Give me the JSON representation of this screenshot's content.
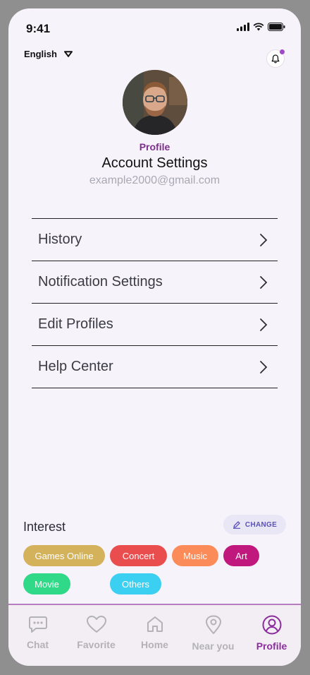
{
  "status": {
    "time": "9:41"
  },
  "language": {
    "selected": "English"
  },
  "profile": {
    "label": "Profile",
    "title": "Account Settings",
    "email": "example2000@gmail.com"
  },
  "menu": {
    "items": [
      {
        "label": "History"
      },
      {
        "label": "Notification Settings"
      },
      {
        "label": "Edit Profiles"
      },
      {
        "label": "Help Center"
      }
    ]
  },
  "interest": {
    "title": "Interest",
    "change_label": "CHANGE",
    "tags": [
      {
        "label": "Games Online",
        "color": "#d4b25c"
      },
      {
        "label": "Concert",
        "color": "#ea4d4d"
      },
      {
        "label": "Music",
        "color": "#fb8b58"
      },
      {
        "label": "Art",
        "color": "#c0187d"
      },
      {
        "label": "Movie",
        "color": "#2fd988"
      },
      {
        "label": "Others",
        "color": "#3bd0f1"
      }
    ]
  },
  "nav": {
    "items": [
      {
        "label": "Chat",
        "icon": "chat-icon"
      },
      {
        "label": "Favorite",
        "icon": "heart-icon"
      },
      {
        "label": "Home",
        "icon": "home-icon"
      },
      {
        "label": "Near you",
        "icon": "location-pin-icon"
      },
      {
        "label": "Profile",
        "icon": "user-circle-icon",
        "active": true
      }
    ]
  },
  "colors": {
    "accent": "#8c2d9e",
    "background": "#f7f3fa"
  }
}
